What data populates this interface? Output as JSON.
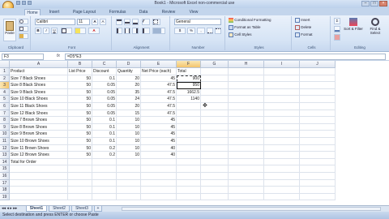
{
  "window": {
    "title": "Book1 - Microsoft Excel non-commercial use"
  },
  "ribbon": {
    "tabs": [
      "Home",
      "Insert",
      "Page Layout",
      "Formulas",
      "Data",
      "Review",
      "View"
    ],
    "clipboard": {
      "paste": "Paste",
      "label": "Clipboard"
    },
    "font": {
      "name": "Calibri",
      "size": "11",
      "label": "Font"
    },
    "alignment": {
      "label": "Alignment"
    },
    "number": {
      "format": "General",
      "label": "Number"
    },
    "styles": {
      "conditional": "Conditional Formatting",
      "table": "Format as Table",
      "cell_styles": "Cell Styles",
      "label": "Styles"
    },
    "cells": {
      "insert": "Insert",
      "delete": "Delete",
      "format": "Format",
      "label": "Cells"
    },
    "editing": {
      "sort": "Sort & Filter",
      "find": "Find & Select",
      "label": "Editing"
    }
  },
  "formula_bar": {
    "name_box": "F3",
    "fx": "fx",
    "formula": "=D5*E3"
  },
  "columns": [
    "A",
    "B",
    "C",
    "D",
    "E",
    "F",
    "G",
    "H",
    "I",
    "J"
  ],
  "headers": {
    "product": "Product",
    "list_price": "List Price",
    "discount": "Discount",
    "quantity": "Quantity",
    "net_price": "Net Price (each)",
    "total": "Total"
  },
  "rows": [
    {
      "n": "1",
      "product": "Product",
      "list": "List Price",
      "discount": "Discount",
      "qty": "Quantity",
      "net": "Net Price (each)",
      "total": "Total"
    },
    {
      "n": "2",
      "product": "Size 7 Black Shoes",
      "list": "50",
      "discount": "0.1",
      "qty": "20",
      "net": "45",
      "total": "900"
    },
    {
      "n": "3",
      "product": "Size 8 Black Shoes",
      "list": "50",
      "discount": "0.05",
      "qty": "20",
      "net": "47.5",
      "total": "950"
    },
    {
      "n": "4",
      "product": "Size 9 Black Shoes",
      "list": "50",
      "discount": "0.05",
      "qty": "35",
      "net": "47.5",
      "total": "1662.5"
    },
    {
      "n": "5",
      "product": "Size 10 Black Shoes",
      "list": "50",
      "discount": "0.05",
      "qty": "24",
      "net": "47.5",
      "total": "1140"
    },
    {
      "n": "6",
      "product": "Size 11 Black Shoes",
      "list": "50",
      "discount": "0.05",
      "qty": "20",
      "net": "47.5",
      "total": ""
    },
    {
      "n": "7",
      "product": "Size 12 Black Shoes",
      "list": "50",
      "discount": "0.05",
      "qty": "15",
      "net": "47.5",
      "total": ""
    },
    {
      "n": "8",
      "product": "Size 7 Brown Shoes",
      "list": "50",
      "discount": "0.1",
      "qty": "10",
      "net": "45",
      "total": ""
    },
    {
      "n": "9",
      "product": "Size 8 Brown Shoes",
      "list": "50",
      "discount": "0.1",
      "qty": "10",
      "net": "45",
      "total": ""
    },
    {
      "n": "10",
      "product": "Size 9 Brown Shoes",
      "list": "50",
      "discount": "0.1",
      "qty": "10",
      "net": "45",
      "total": ""
    },
    {
      "n": "11",
      "product": "Size 10 Brown Shoes",
      "list": "50",
      "discount": "0.1",
      "qty": "10",
      "net": "45",
      "total": ""
    },
    {
      "n": "12",
      "product": "Size 11 Brown Shoes",
      "list": "50",
      "discount": "0.2",
      "qty": "10",
      "net": "40",
      "total": ""
    },
    {
      "n": "13",
      "product": "Size 12 Brown Shoes",
      "list": "50",
      "discount": "0.2",
      "qty": "10",
      "net": "40",
      "total": ""
    },
    {
      "n": "14",
      "product": "Total for Order",
      "list": "",
      "discount": "",
      "qty": "",
      "net": "",
      "total": ""
    },
    {
      "n": "15",
      "product": "",
      "list": "",
      "discount": "",
      "qty": "",
      "net": "",
      "total": ""
    },
    {
      "n": "16",
      "product": "",
      "list": "",
      "discount": "",
      "qty": "",
      "net": "",
      "total": ""
    },
    {
      "n": "17",
      "product": "",
      "list": "",
      "discount": "",
      "qty": "",
      "net": "",
      "total": ""
    },
    {
      "n": "18",
      "product": "",
      "list": "",
      "discount": "",
      "qty": "",
      "net": "",
      "total": ""
    },
    {
      "n": "19",
      "product": "",
      "list": "",
      "discount": "",
      "qty": "",
      "net": "",
      "total": ""
    }
  ],
  "sheets": [
    "Sheet1",
    "Sheet2",
    "Sheet3"
  ],
  "status": {
    "text": "Select destination and press ENTER or choose Paste"
  },
  "colors": {
    "accent": "#f3c46c",
    "ribbon": "#d6e4f5"
  }
}
